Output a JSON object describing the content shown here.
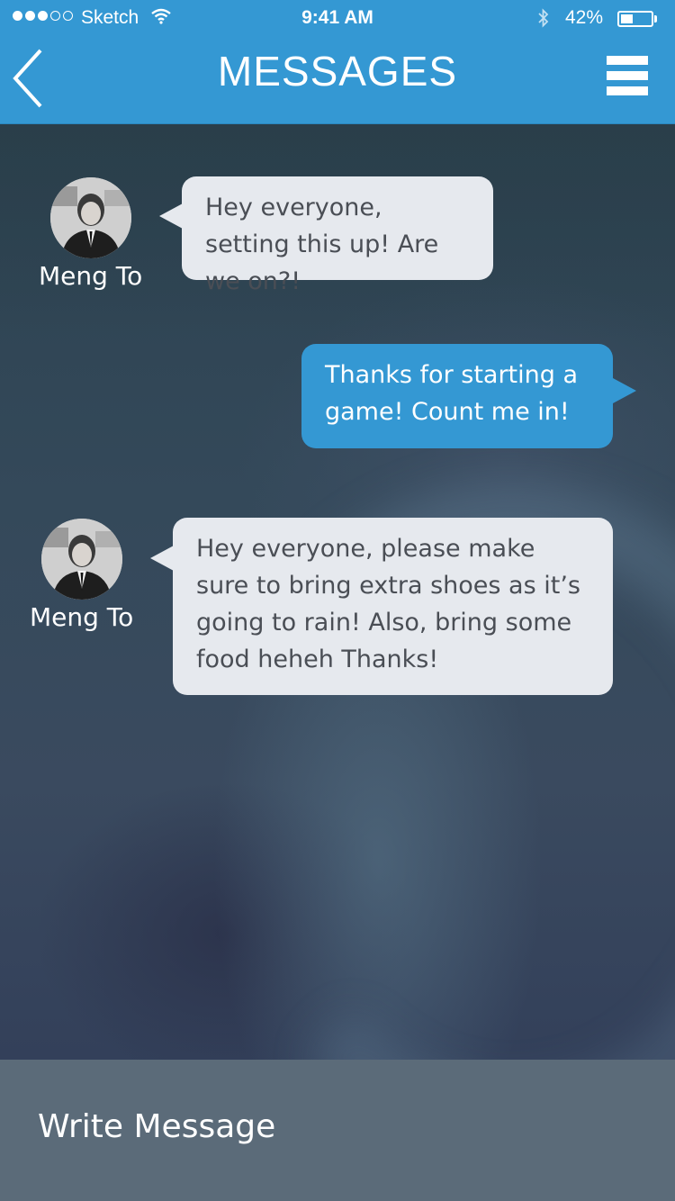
{
  "status_bar": {
    "carrier": "Sketch",
    "time": "9:41 AM",
    "battery": "42%",
    "battery_level": 0.42,
    "signal_bars": 5,
    "signal_filled": 3
  },
  "nav": {
    "title": "MESSAGES",
    "back_icon": "chevron-left-icon",
    "menu_icon": "hamburger-menu-icon"
  },
  "messages": [
    {
      "sender": "Meng To",
      "direction": "incoming",
      "text": "Hey everyone, setting this up! Are we on?!"
    },
    {
      "sender": "",
      "direction": "outgoing",
      "text": "Thanks for starting a game! Count me in!"
    },
    {
      "sender": "Meng To",
      "direction": "incoming",
      "text": "Hey everyone, please make sure to bring extra shoes as it’s going to rain! Also, bring some food heheh Thanks!"
    }
  ],
  "compose": {
    "placeholder": "Write Message"
  },
  "colors": {
    "accent": "#3498d3",
    "bubble_incoming": "#e6e9ee",
    "compose_bar": "#5b6b79"
  }
}
